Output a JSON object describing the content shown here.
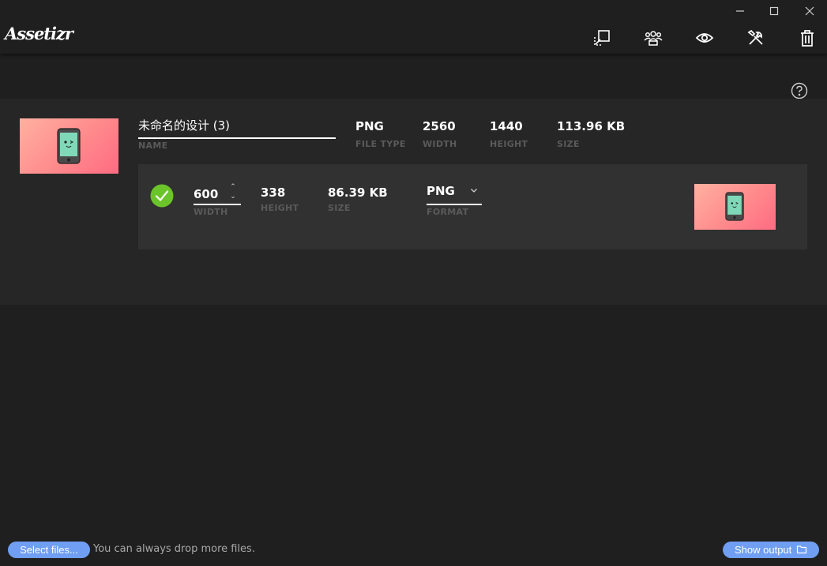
{
  "app": {
    "logo_text": "Assetizr"
  },
  "window_controls": {
    "icons": [
      "minimize-icon",
      "maximize-icon",
      "close-icon"
    ]
  },
  "toolbar": {
    "icons": [
      "resize-icon",
      "people-icon",
      "eye-icon",
      "tools-icon",
      "trash-icon"
    ]
  },
  "help": {
    "icon": "question-circle-icon"
  },
  "file": {
    "name": "未命名的设计 (3)",
    "name_label": "NAME",
    "file_type": "PNG",
    "file_type_label": "FILE TYPE",
    "width": "2560",
    "width_label": "WIDTH",
    "height": "1440",
    "height_label": "HEIGHT",
    "size": "113.96 KB",
    "size_label": "SIZE",
    "thumbnail_icon": "phone-character-icon"
  },
  "output": {
    "status_icon": "check-circle-icon",
    "width": "600",
    "width_label": "WIDTH",
    "height": "338",
    "height_label": "HEIGHT",
    "size": "86.39 KB",
    "size_label": "SIZE",
    "format": "PNG",
    "format_label": "FORMAT"
  },
  "footer": {
    "select_files_label": "Select files...",
    "hint": "You can always drop more files.",
    "show_output_label": "Show output"
  },
  "colors": {
    "background": "#1f1f1f",
    "panel": "#262626",
    "card": "#313131",
    "accent_blue": "#6f9ef2",
    "success_green": "#6bc42a",
    "muted_label": "#5a5a5a",
    "thumb_gradient_start": "#ffb0a0",
    "thumb_gradient_end": "#ff6b82"
  }
}
